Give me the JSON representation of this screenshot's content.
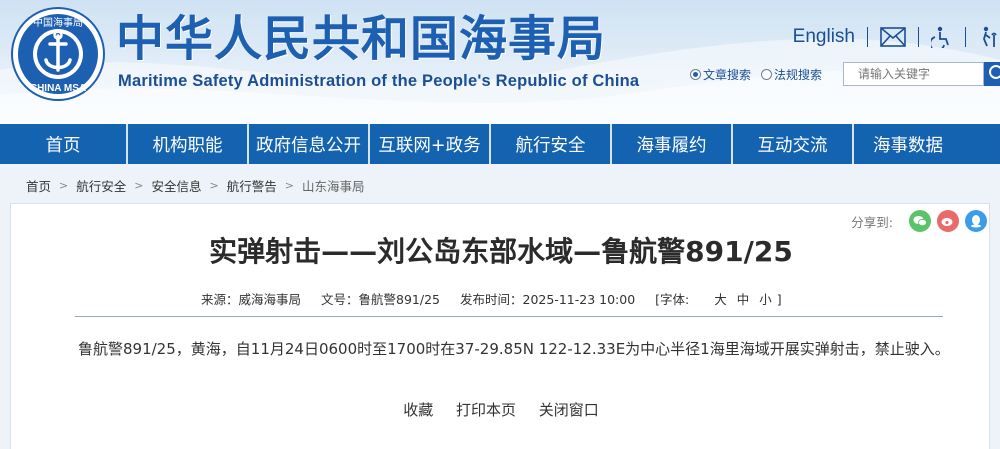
{
  "header": {
    "title": "中华人民共和国海事局",
    "subtitle": "Maritime Safety Administration of the People's Republic of China",
    "logo": {
      "text_top": "中国海事局",
      "text_bottom": "CHINA MSA"
    },
    "english_label": "English",
    "icons": [
      "mail-icon",
      "accessibility-icon",
      "elderly-icon"
    ],
    "search": {
      "option_article": "文章搜索",
      "option_regulation": "法规搜索",
      "selected": "文章搜索",
      "placeholder": "请输入关键字"
    }
  },
  "nav": {
    "items": [
      "首页",
      "机构职能",
      "政府信息公开",
      "互联网+政务",
      "航行安全",
      "海事履约",
      "互动交流",
      "海事数据"
    ]
  },
  "breadcrumb": [
    "首页",
    "航行安全",
    "安全信息",
    "航行警告",
    "山东海事局"
  ],
  "article": {
    "share_label": "分享到:",
    "title": "实弹射击——刘公岛东部水域—鲁航警891/25",
    "source": "来源：威海海事局",
    "doc_no": "文号：鲁航警891/25",
    "publish_time": "发布时间：2025-11-23 10:00",
    "font_label": "[字体:",
    "font_large": "大",
    "font_medium": "中",
    "font_small": "小",
    "font_close": "]",
    "body": "鲁航警891/25，黄海，自11月24日0600时至1700时在37-29.85N 122-12.33E为中心半径1海里海域开展实弹射击，禁止驶入。",
    "actions": [
      "收藏",
      "打印本页",
      "关闭窗口"
    ]
  },
  "colors": {
    "brand_blue": "#1d5fb0",
    "nav_blue": "#1463b0",
    "wechat_green": "#5cc36b",
    "weibo_red": "#e86a6a",
    "qq_blue": "#3d9ce8"
  }
}
